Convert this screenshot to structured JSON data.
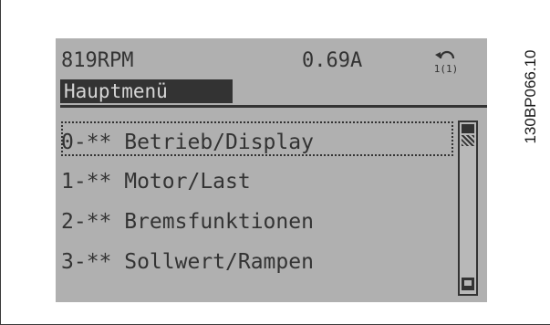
{
  "display": {
    "status": {
      "rpm": "819RPM",
      "current": "0.69A",
      "setup_icon": "setup-1-icon",
      "setup_label": "1(1)"
    },
    "title": "Hauptmenü",
    "menu_items": [
      {
        "label": "0-** Betrieb/Display",
        "selected": true
      },
      {
        "label": "1-** Motor/Last",
        "selected": false
      },
      {
        "label": "2-** Bremsfunktionen",
        "selected": false
      },
      {
        "label": "3-** Sollwert/Rampen",
        "selected": false
      }
    ],
    "scroll_position": 0.0
  },
  "figure_id": "130BP066.10",
  "colors": {
    "lcd_background": "#b0b0b0",
    "lcd_foreground": "#333333",
    "title_text": "#d6d6d6"
  }
}
